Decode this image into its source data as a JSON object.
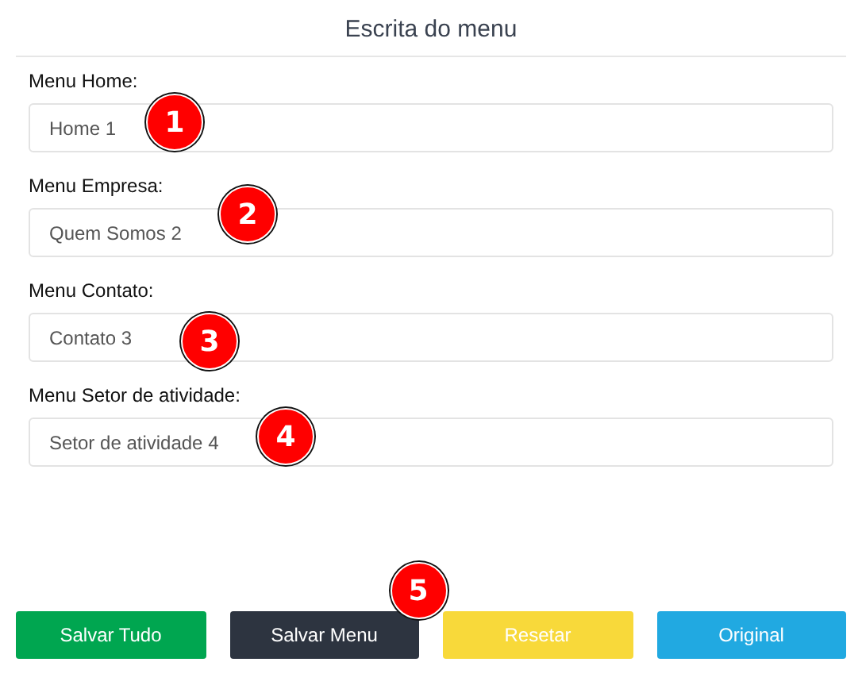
{
  "title": "Escrita do menu",
  "fields": [
    {
      "label": "Menu Home:",
      "value": "Home 1",
      "badge": "1"
    },
    {
      "label": "Menu Empresa:",
      "value": "Quem Somos 2",
      "badge": "2"
    },
    {
      "label": "Menu Contato:",
      "value": "Contato 3",
      "badge": "3"
    },
    {
      "label": "Menu Setor de atividade:",
      "value": "Setor de atividade 4",
      "badge": "4"
    }
  ],
  "buttons": [
    {
      "label": "Salvar Tudo",
      "color": "#00a650"
    },
    {
      "label": "Salvar Menu",
      "color": "#2d3440",
      "badge": "5"
    },
    {
      "label": "Resetar",
      "color": "#f8d93a"
    },
    {
      "label": "Original",
      "color": "#21a9e1"
    }
  ]
}
